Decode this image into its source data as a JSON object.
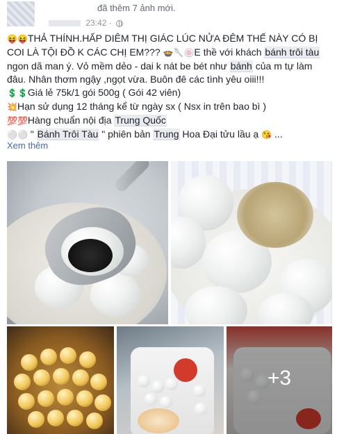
{
  "header": {
    "action_text": "đã thêm 7 ảnh mới.",
    "time": "23:42 ·"
  },
  "post": {
    "lines": [
      {
        "parts": [
          {
            "t": "😝😝",
            "k": "emoji"
          },
          {
            "t": "THẢ THÍNH.HẤP DIÊM THỊ GIÁC LÚC NỬA ĐÊM THẾ NÀY CÓ BỊ",
            "k": "text"
          }
        ]
      },
      {
        "parts": [
          {
            "t": "COI LÀ TỘI ĐỒ K CÁC CHỊ EM??? ",
            "k": "text"
          },
          {
            "t": "🍲🥄🍥",
            "k": "emoji"
          },
          {
            "t": "E thề với khách ",
            "k": "text"
          },
          {
            "t": "bánh trôi tàu",
            "k": "hl"
          }
        ]
      },
      {
        "parts": [
          {
            "t": "ngon dã man ý. Vỏ mềm dẻo - dai k nát be bét như ",
            "k": "text"
          },
          {
            "t": "bánh",
            "k": "hl"
          },
          {
            "t": " của m tự làm",
            "k": "text"
          }
        ]
      },
      {
        "parts": [
          {
            "t": "đâu. Nhân thơm ngậy ,ngọt vừa. Buôn đê các tình yêu oiii!!!",
            "k": "text"
          }
        ]
      },
      {
        "parts": [
          {
            "t": "💲💲",
            "k": "emoji"
          },
          {
            "t": "Giá lẻ 75k/1 gói 500g ( Gói 42 viên)",
            "k": "text"
          }
        ]
      },
      {
        "parts": [
          {
            "t": "💥",
            "k": "emoji"
          },
          {
            "t": "Hạn sử dụng 12 tháng kể từ ngày sx ( Nsx in trên bao bì )",
            "k": "text"
          }
        ]
      },
      {
        "parts": [
          {
            "t": "💯💯",
            "k": "emoji"
          },
          {
            "t": "Hàng chuẩn nội địa ",
            "k": "text"
          },
          {
            "t": "Trung Quốc",
            "k": "hl"
          }
        ]
      },
      {
        "parts": [
          {
            "t": "⚪⚪",
            "k": "emoji"
          },
          {
            "t": " \" ",
            "k": "text"
          },
          {
            "t": "Bánh Trôi Tàu",
            "k": "hl"
          },
          {
            "t": " \" phiên bản ",
            "k": "text"
          },
          {
            "t": "Trung",
            "k": "hl"
          },
          {
            "t": " Hoa Đại tửu lầu ạ ",
            "k": "text"
          },
          {
            "t": "😘",
            "k": "emoji"
          },
          {
            "t": " ...",
            "k": "text"
          }
        ]
      }
    ],
    "see_more": "Xem thêm"
  },
  "photos": {
    "more_count": "+3"
  },
  "colors": {
    "link": "#4267b2",
    "meta": "#90949c",
    "highlight_bg": "#e9ebee"
  }
}
